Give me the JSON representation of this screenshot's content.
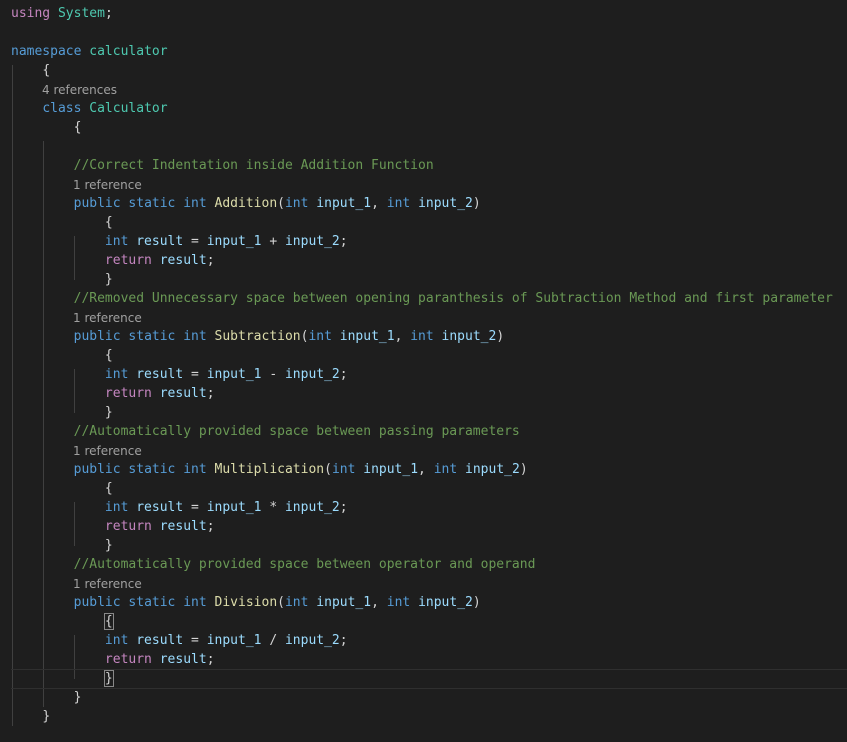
{
  "code": {
    "using_kw": "using",
    "using_ns": "System",
    "semicolon": ";",
    "namespace_kw": "namespace",
    "namespace_name": "calculator",
    "open_brace": "{",
    "close_brace": "}",
    "class_kw": "class",
    "class_name": "Calculator",
    "public_kw": "public",
    "static_kw": "static",
    "int_kw": "int",
    "return_kw": "return",
    "result_var": "result",
    "param1": "input_1",
    "param2": "input_2",
    "lens_class": "4 references",
    "lens_method": "1 reference",
    "comments": {
      "addition": "//Correct Indentation inside Addition Function",
      "subtraction": "//Removed Unnecessary space between opening paranthesis of Subtraction Method and first parameter",
      "multiplication": "//Automatically provided space between passing parameters",
      "division": "//Automatically provided space between operator and operand"
    },
    "methods": {
      "addition": "Addition",
      "subtraction": "Subtraction",
      "multiplication": "Multiplication",
      "division": "Division"
    },
    "ops": {
      "plus": "+",
      "minus": "-",
      "times": "*",
      "divide": "/"
    }
  },
  "colors": {
    "background": "#1e1e1e",
    "keyword": "#569cd6",
    "control_keyword": "#c586c0",
    "type_name": "#4ec9b0",
    "function_name": "#dcdcaa",
    "variable": "#9cdcfe",
    "comment": "#6a9955",
    "codelens": "#a0a0a0"
  }
}
